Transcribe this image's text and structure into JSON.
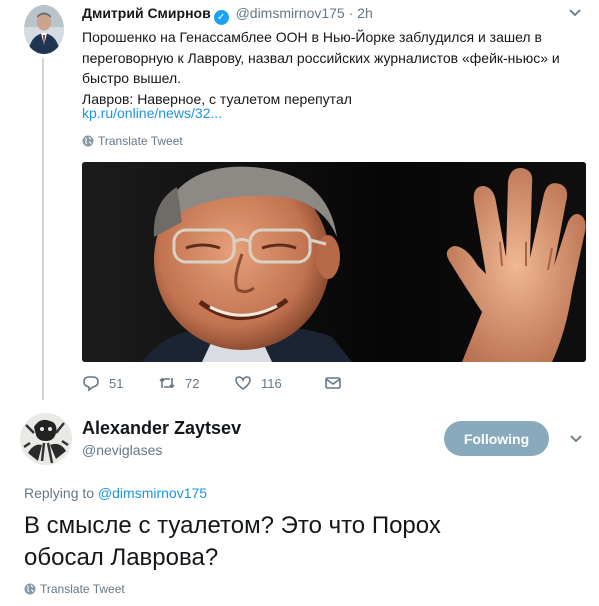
{
  "tweet1": {
    "name": "Дмитрий Смирнов",
    "handle": "@dimsmirnov175",
    "separator": "·",
    "time": "2h",
    "lines": [
      "Порошенко на Генассамблее ООН в Нью-Йорке заблудился и зашел в",
      "переговорную к Лаврову, назвал российских журналистов «фейк-ньюс» и",
      "быстро вышел.",
      "Лавров: Наверное, с туалетом перепутал"
    ],
    "link": "kp.ru/online/news/32...",
    "translate": "Translate Tweet",
    "stats": {
      "replies": "51",
      "retweets": "72",
      "likes": "116"
    }
  },
  "tweet2": {
    "name": "Alexander Zaytsev",
    "handle": "@neviglases",
    "follow_label": "Following",
    "replying_prefix": "Replying to",
    "replying_handle": "@dimsmirnov175",
    "text_lines": [
      "В смысле с туалетом? Это что Порох",
      "обосал Лаврова?"
    ],
    "translate": "Translate Tweet"
  },
  "colors": {
    "link": "#1b95e0",
    "verified": "#1da1f2",
    "muted": "#657786",
    "following_button": "#89a9bd",
    "thread_line": "#ccd6dd"
  },
  "icons": [
    "verified-icon",
    "chevron-down-icon",
    "globe-icon",
    "reply-icon",
    "retweet-icon",
    "like-icon",
    "dm-icon"
  ]
}
